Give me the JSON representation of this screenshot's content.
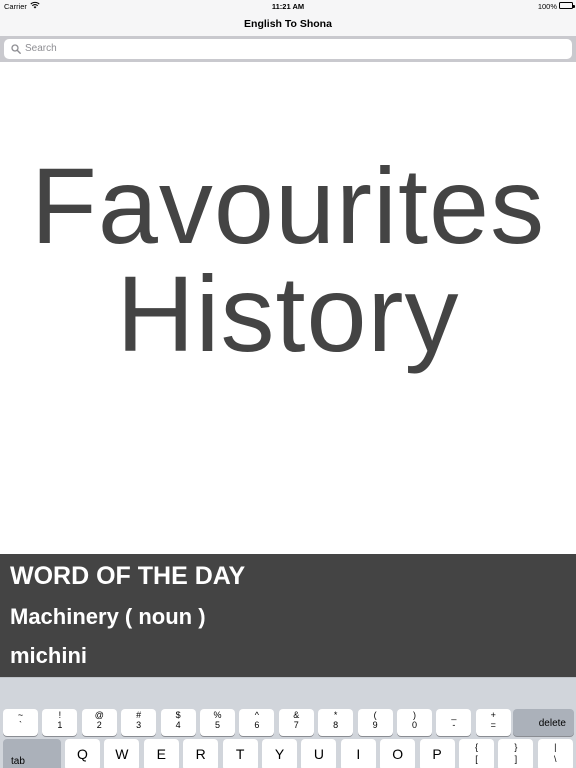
{
  "status_bar": {
    "carrier": "Carrier",
    "time": "11:21 AM",
    "battery": "100%"
  },
  "nav": {
    "title": "English To Shona"
  },
  "search": {
    "placeholder": "Search"
  },
  "hero": {
    "favourites": "Favourites",
    "history": "History"
  },
  "word_of_day": {
    "heading": "WORD OF THE DAY",
    "word": "Machinery ( noun )",
    "translation": "michini"
  },
  "keyboard": {
    "number_row": [
      {
        "top": "~",
        "bottom": "`"
      },
      {
        "top": "!",
        "bottom": "1"
      },
      {
        "top": "@",
        "bottom": "2"
      },
      {
        "top": "#",
        "bottom": "3"
      },
      {
        "top": "$",
        "bottom": "4"
      },
      {
        "top": "%",
        "bottom": "5"
      },
      {
        "top": "^",
        "bottom": "6"
      },
      {
        "top": "&",
        "bottom": "7"
      },
      {
        "top": "*",
        "bottom": "8"
      },
      {
        "top": "(",
        "bottom": "9"
      },
      {
        "top": ")",
        "bottom": "0"
      },
      {
        "top": "_",
        "bottom": "-"
      },
      {
        "top": "+",
        "bottom": "="
      }
    ],
    "delete_label": "delete",
    "tab_label": "tab",
    "letter_row": [
      "Q",
      "W",
      "E",
      "R",
      "T",
      "Y",
      "U",
      "I",
      "O",
      "P"
    ],
    "bracket_row": [
      {
        "top": "{",
        "bottom": "["
      },
      {
        "top": "}",
        "bottom": "]"
      },
      {
        "top": "|",
        "bottom": "\\"
      }
    ]
  }
}
